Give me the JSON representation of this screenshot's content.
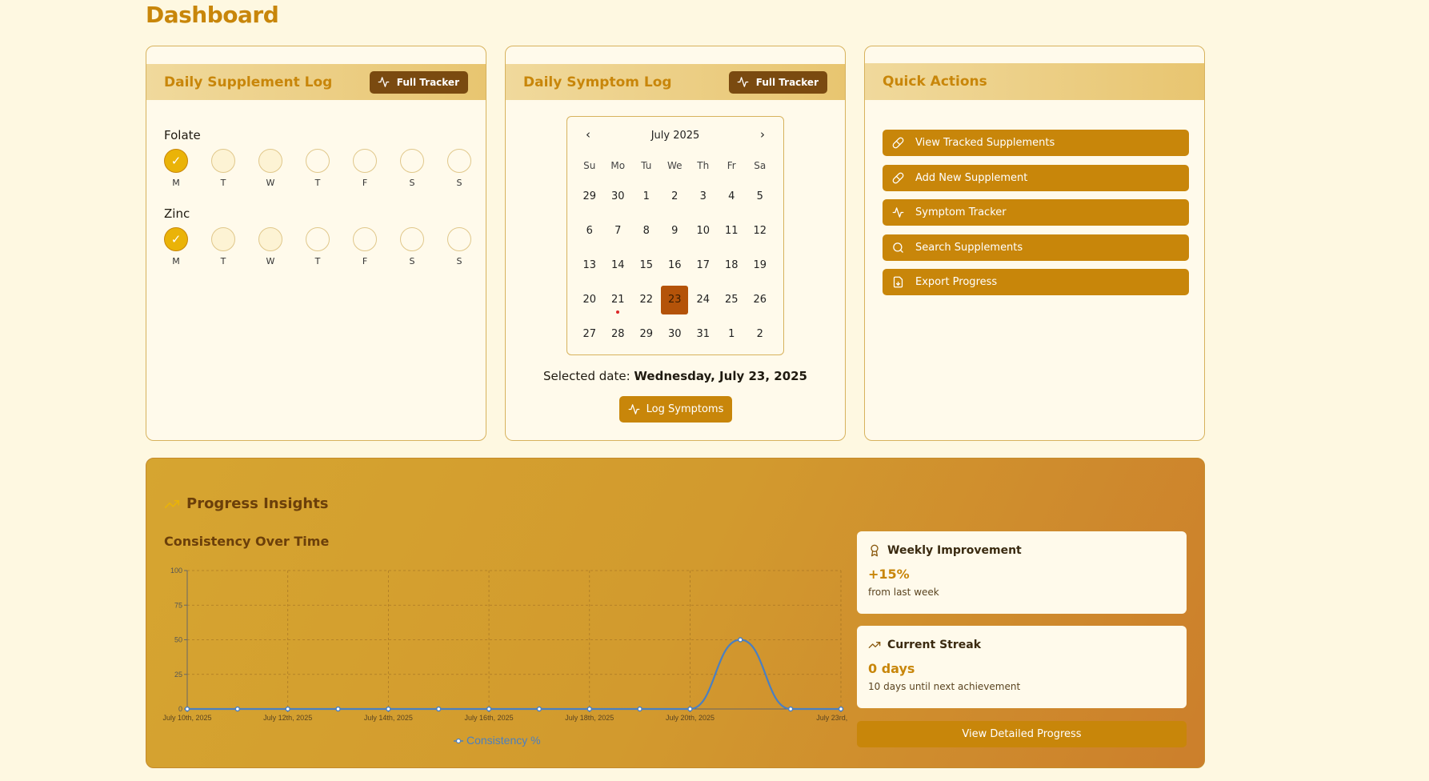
{
  "page": {
    "title": "Dashboard"
  },
  "supplement_log": {
    "title": "Daily Supplement Log",
    "full_tracker_label": "Full Tracker",
    "supplements": [
      {
        "name": "Folate",
        "days": [
          "M",
          "T",
          "W",
          "T",
          "F",
          "S",
          "S"
        ],
        "checked": [
          true,
          false,
          false,
          false,
          false,
          false,
          false
        ]
      },
      {
        "name": "Zinc",
        "days": [
          "M",
          "T",
          "W",
          "T",
          "F",
          "S",
          "S"
        ],
        "checked": [
          true,
          false,
          false,
          false,
          false,
          false,
          false
        ]
      }
    ],
    "check_mark": "✓"
  },
  "symptom_log": {
    "title": "Daily Symptom Log",
    "full_tracker_label": "Full Tracker",
    "calendar": {
      "month_label": "July 2025",
      "prev": "‹",
      "next": "›",
      "weekdays": [
        "Su",
        "Mo",
        "Tu",
        "We",
        "Th",
        "Fr",
        "Sa"
      ],
      "weeks": [
        [
          "29",
          "30",
          "1",
          "2",
          "3",
          "4",
          "5"
        ],
        [
          "6",
          "7",
          "8",
          "9",
          "10",
          "11",
          "12"
        ],
        [
          "13",
          "14",
          "15",
          "16",
          "17",
          "18",
          "19"
        ],
        [
          "20",
          "21",
          "22",
          "23",
          "24",
          "25",
          "26"
        ],
        [
          "27",
          "28",
          "29",
          "30",
          "31",
          "1",
          "2"
        ]
      ],
      "selected_day": "23",
      "marked_day": "21"
    },
    "selected_prefix": "Selected date: ",
    "selected_date": "Wednesday, July 23, 2025",
    "log_button": "Log Symptoms"
  },
  "quick_actions": {
    "title": "Quick Actions",
    "items": [
      {
        "label": "View Tracked Supplements",
        "icon": "pill-icon"
      },
      {
        "label": "Add New Supplement",
        "icon": "pill-icon"
      },
      {
        "label": "Symptom Tracker",
        "icon": "activity-icon"
      },
      {
        "label": "Search Supplements",
        "icon": "search-icon"
      },
      {
        "label": "Export Progress",
        "icon": "file-icon"
      }
    ]
  },
  "insights": {
    "title": "Progress Insights",
    "chart_title": "Consistency Over Time",
    "weekly": {
      "title": "Weekly Improvement",
      "value": "+15%",
      "sub": "from last week"
    },
    "streak": {
      "title": "Current Streak",
      "value": "0 days",
      "sub": "10 days until next achievement"
    },
    "detail_button": "View Detailed Progress"
  },
  "chart_data": {
    "type": "line",
    "x": [
      "July 10th, 2025",
      "July 11th, 2025",
      "July 12th, 2025",
      "July 13th, 2025",
      "July 14th, 2025",
      "July 15th, 2025",
      "July 16th, 2025",
      "July 17th, 2025",
      "July 18th, 2025",
      "July 19th, 2025",
      "July 20th, 2025",
      "July 21st, 2025",
      "July 22nd, 2025",
      "July 23rd, 2025"
    ],
    "x_tick_labels": [
      "July 10th, 2025",
      "July 12th, 2025",
      "July 14th, 2025",
      "July 16th, 2025",
      "July 18th, 2025",
      "July 20th, 2025",
      "July 23rd, 2025"
    ],
    "series": [
      {
        "name": "Consistency %",
        "values": [
          0,
          0,
          0,
          0,
          0,
          0,
          0,
          0,
          0,
          0,
          0,
          50,
          0,
          0
        ]
      }
    ],
    "ylim": [
      0,
      100
    ],
    "yticks": [
      0,
      25,
      50,
      75,
      100
    ],
    "grid": true,
    "legend": "bottom",
    "line_color": "#4a7fc1"
  }
}
